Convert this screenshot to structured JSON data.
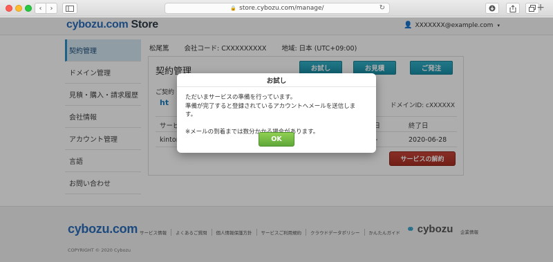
{
  "browser": {
    "url": "store.cybozu.com/manage/",
    "nav_back": "‹",
    "nav_forward": "›",
    "reload_icon": "↻",
    "new_tab": "+"
  },
  "header": {
    "logo_brand": "cybozu.com",
    "logo_suffix": "Store",
    "user_email": "XXXXXXX@example.com",
    "user_caret": "▾"
  },
  "sidebar": {
    "items": [
      {
        "label": "契約管理",
        "active": true
      },
      {
        "label": "ドメイン管理"
      },
      {
        "label": "見積・購入・請求履歴"
      },
      {
        "label": "会社情報"
      },
      {
        "label": "アカウント管理"
      },
      {
        "label": "言語"
      },
      {
        "label": "お問い合わせ"
      }
    ]
  },
  "meta": {
    "name": "松尾篤",
    "company_code": "会社コード: CXXXXXXXXX",
    "region": "地域: 日本 (UTC+09:00)"
  },
  "panel": {
    "title": "契約管理",
    "btn_trial": "お試し",
    "btn_quote": "お見積",
    "btn_order": "ご発注",
    "subtitle": "ご契約",
    "link": "ht",
    "domain_id": "ドメインID: cXXXXXX",
    "col_service": "サービ",
    "col_contract_date": "約日",
    "col_end_date": "終了日",
    "row_service": "kintone",
    "row_dash": "-",
    "row_end_date": "2020-06-28",
    "btn_cancel": "サービスの解約"
  },
  "footer": {
    "logo": "cybozu.com",
    "links": [
      "サービス情報",
      "よくあるご質問",
      "個人情報保護方針",
      "サービスご利用規約",
      "クラウドデータポリシー",
      "かんたんガイド"
    ],
    "brand": "cybozu",
    "corp": "企業情報",
    "copyright": "COPYRIGHT © 2020 Cybozu"
  },
  "modal": {
    "title": "お試し",
    "line1": "ただいまサービスの準備を行っています。",
    "line2": "準備が完了すると登録されているアカウントへメールを送信します。",
    "line3": "※メールの到着までは数分かかる場合があります。",
    "ok": "OK"
  }
}
